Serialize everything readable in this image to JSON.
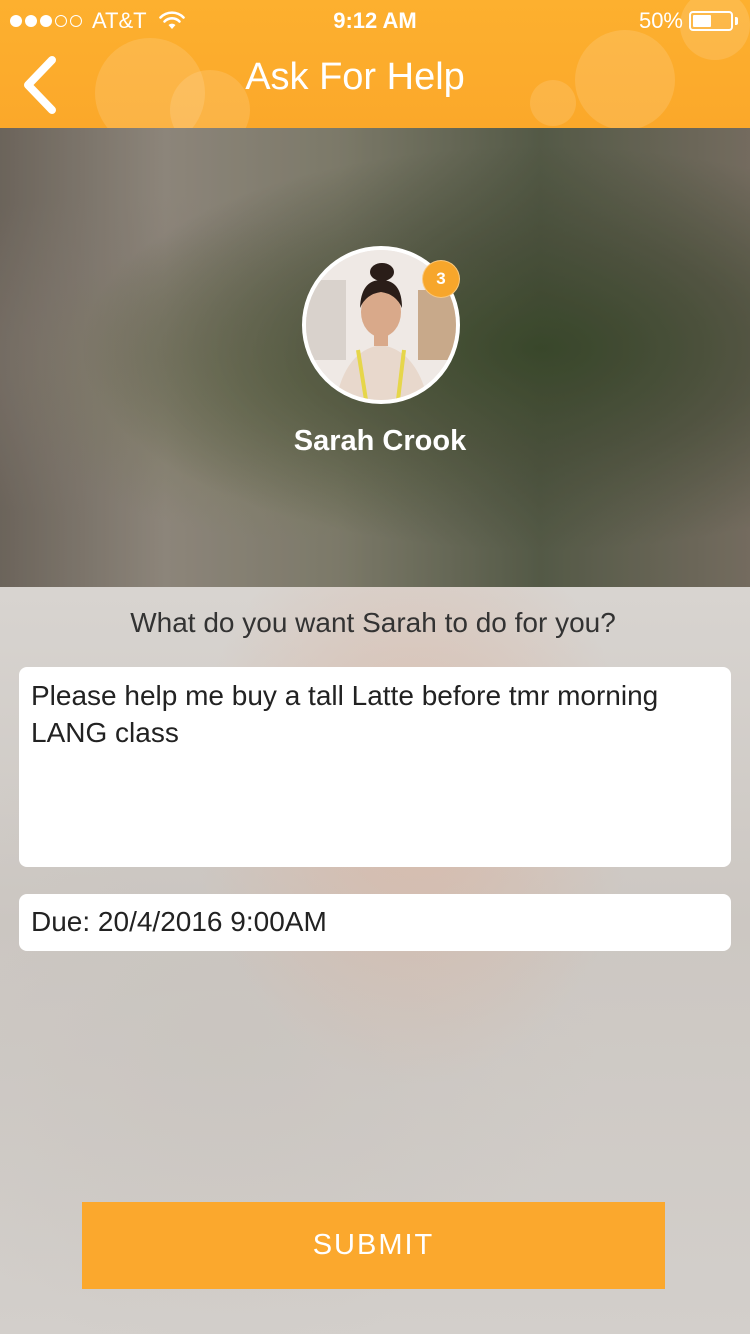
{
  "status_bar": {
    "carrier": "AT&T",
    "signal_bars_filled": 3,
    "signal_bars_total": 5,
    "time": "9:12 AM",
    "battery_percent": "50%",
    "battery_level": 0.5
  },
  "nav": {
    "back_icon": "chevron-left-icon",
    "title": "Ask For Help"
  },
  "profile": {
    "name": "Sarah Crook",
    "badge_count": "3"
  },
  "form": {
    "prompt": "What do you want Sarah to do for you?",
    "message": "Please help me buy a tall Latte before tmr morning LANG class",
    "due": "Due: 20/4/2016 9:00AM",
    "submit_label": "SUBMIT"
  },
  "colors": {
    "accent": "#fba82d",
    "header": "#fdb02f",
    "badge": "#f7a62b"
  }
}
